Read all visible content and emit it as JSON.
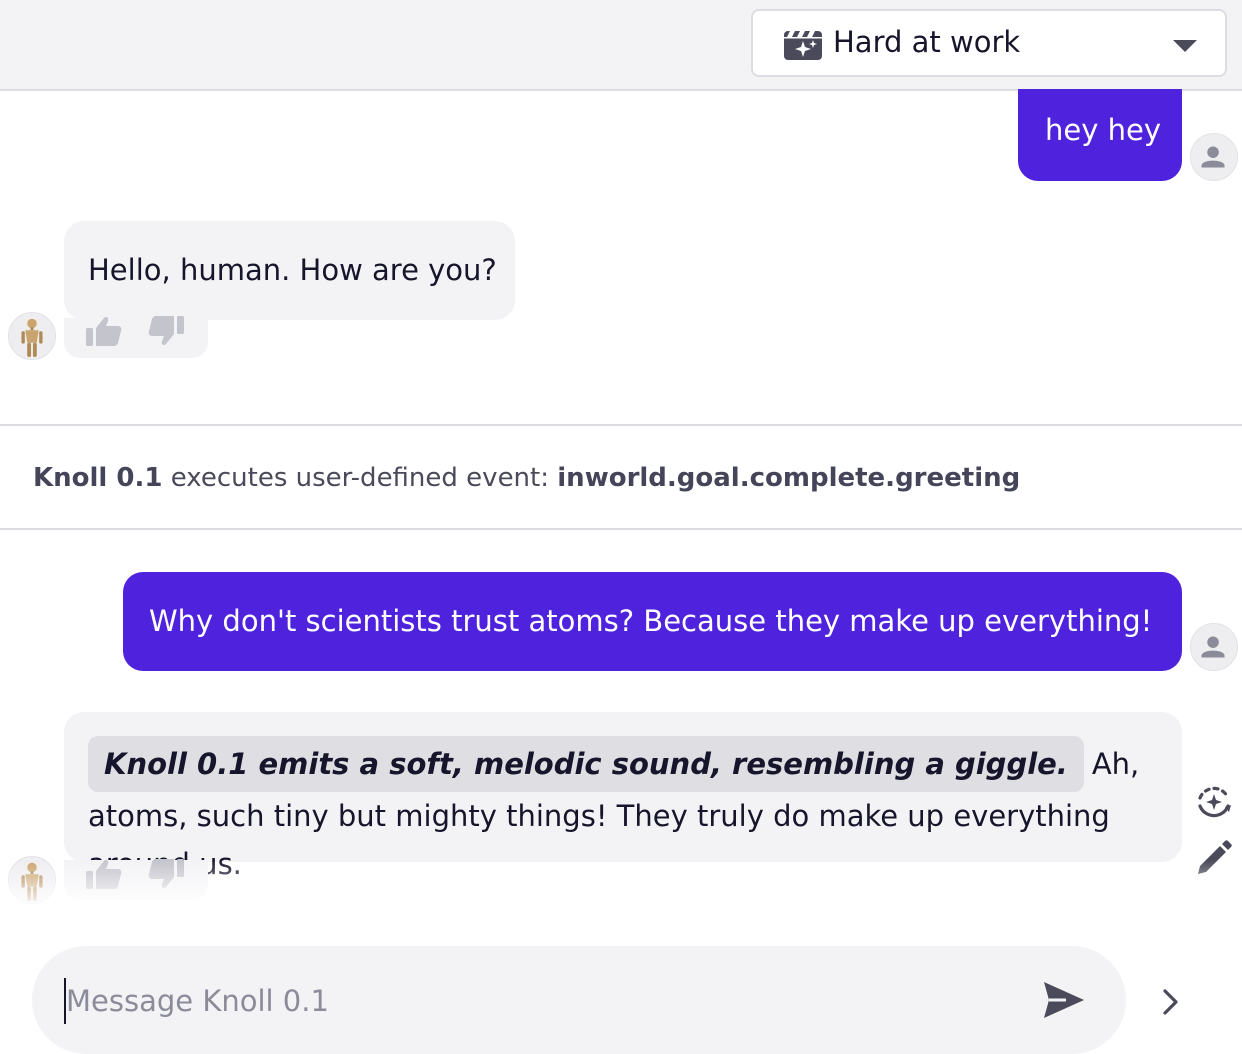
{
  "header": {
    "mood_selector": {
      "icon": "clapperboard-sparkle-icon",
      "label": "Hard at work"
    }
  },
  "messages": [
    {
      "role": "user",
      "text": "hey hey"
    },
    {
      "role": "bot",
      "text": "Hello, human. How are you?"
    },
    {
      "role": "user",
      "text": "Why don't scientists trust atoms? Because they make up everything!"
    },
    {
      "role": "bot",
      "emote": "Knoll 0.1 emits a soft, melodic sound, resembling a giggle.",
      "text": "Ah, atoms, such tiny but mighty things! They truly do make up everything around us."
    }
  ],
  "event": {
    "character": "Knoll 0.1",
    "text": "executes user-defined event:",
    "event_name": "inworld.goal.complete.greeting"
  },
  "composer": {
    "placeholder": "Message Knoll 0.1",
    "value": ""
  },
  "icons": {
    "like": "thumbs-up-icon",
    "dislike": "thumbs-down-icon",
    "regenerate": "regenerate-sparkle-icon",
    "edit": "pencil-icon",
    "send": "send-icon",
    "expand": "chevron-right-icon"
  },
  "colors": {
    "user_bubble": "#4f22dd",
    "bot_bubble": "#f3f3f6",
    "header_bg": "#f3f3f6",
    "text": "#16152b"
  }
}
